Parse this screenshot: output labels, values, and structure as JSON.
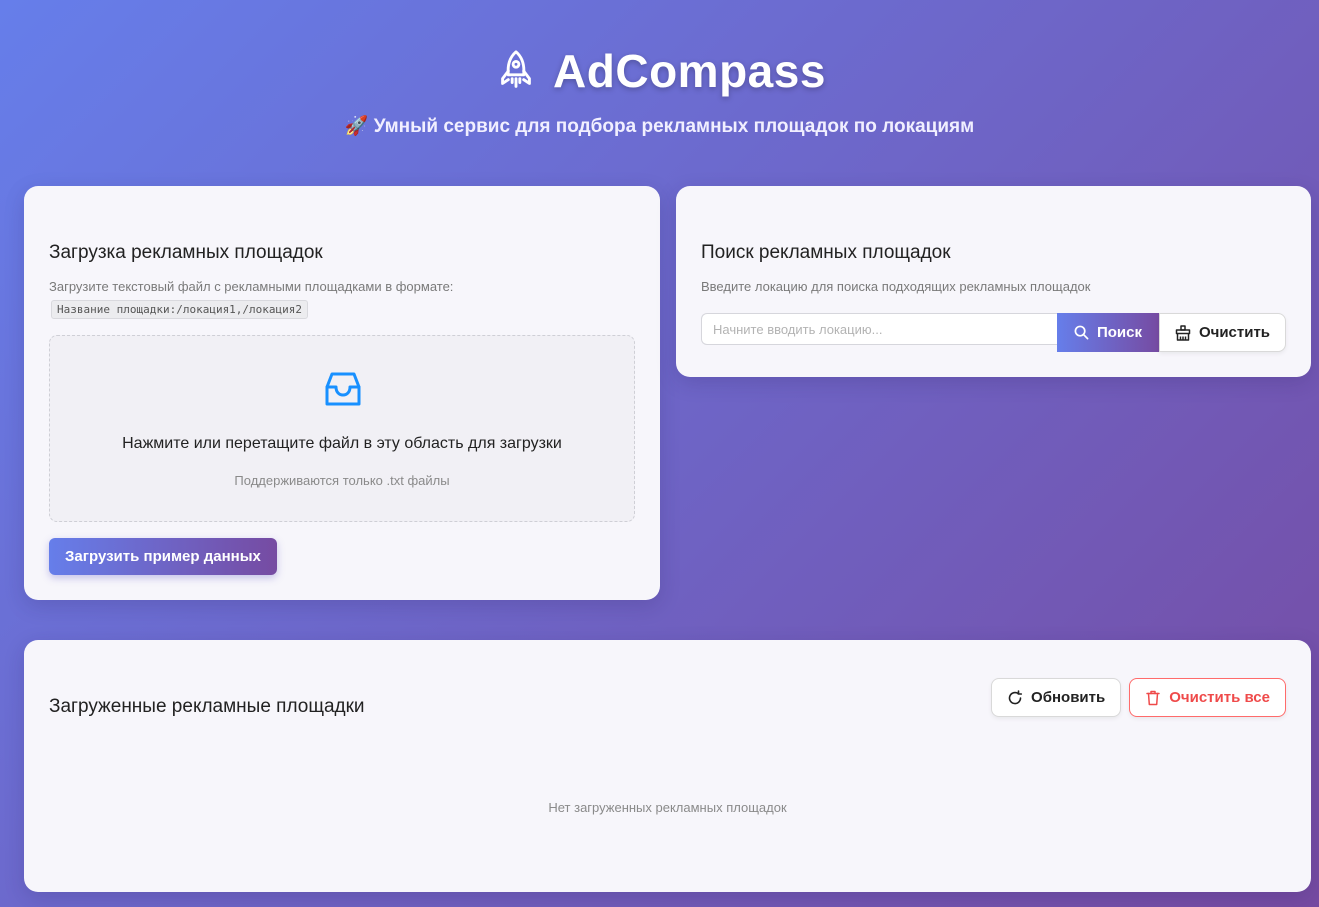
{
  "header": {
    "title": "AdCompass",
    "subtitle": "🚀 Умный сервис для подбора рекламных площадок по локациям"
  },
  "upload": {
    "title": "Загрузка рекламных площадок",
    "hint": "Загрузите текстовый файл с рекламными площадками в формате:",
    "format_example": "Название площадки:/локация1,/локация2",
    "drop_text": "Нажмите или перетащите файл в эту область для загрузки",
    "drop_subtext": "Поддерживаются только .txt файлы",
    "sample_button": "Загрузить пример данных"
  },
  "search": {
    "title": "Поиск рекламных площадок",
    "hint": "Введите локацию для поиска подходящих рекламных площадок",
    "placeholder": "Начните вводить локацию...",
    "value": "",
    "search_button": "Поиск",
    "clear_button": "Очистить"
  },
  "list": {
    "title": "Загруженные рекламные площадки",
    "refresh_button": "Обновить",
    "clear_all_button": "Очистить все",
    "empty_text": "Нет загруженных рекламных площадок"
  },
  "icons": {
    "logo": "rocket-icon",
    "upload": "inbox-icon",
    "search": "search-icon",
    "clear": "broom-icon",
    "refresh": "reload-icon",
    "delete": "trash-icon"
  },
  "colors": {
    "gradient_start": "#667eea",
    "gradient_end": "#764ba2",
    "upload_icon": "#1890ff",
    "danger": "#ef4a4a"
  }
}
